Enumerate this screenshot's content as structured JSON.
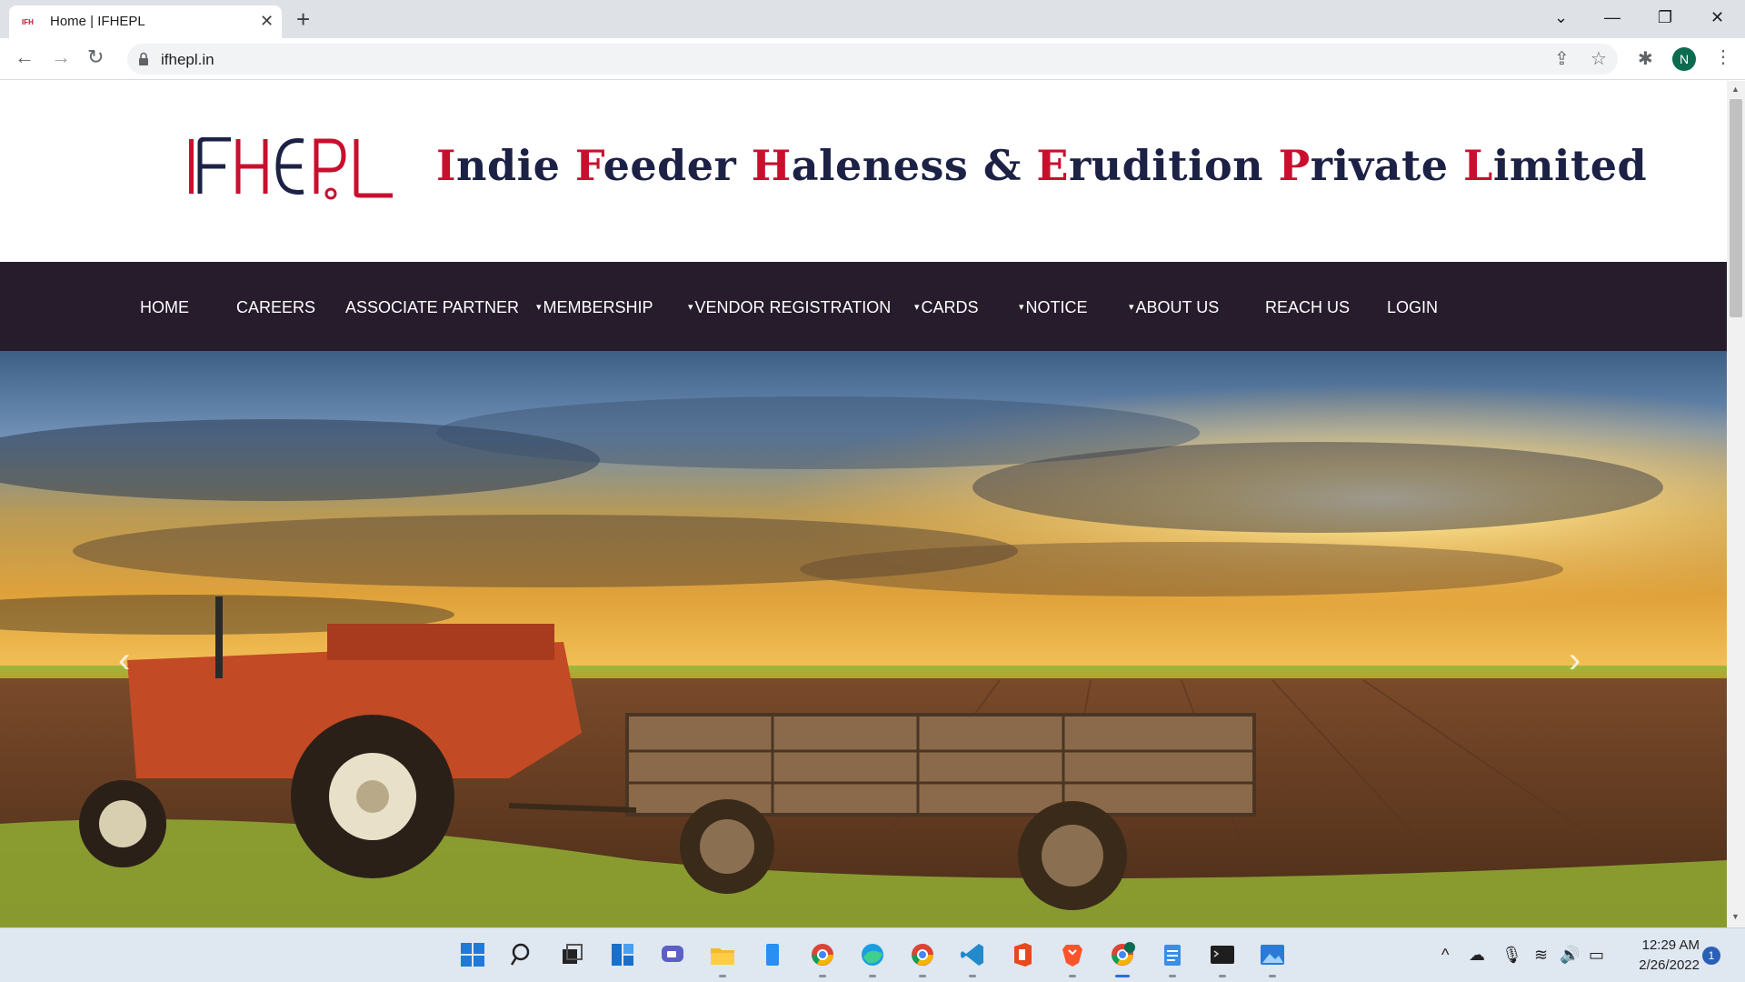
{
  "browser": {
    "tab_title": "Home | IFHEPL",
    "tab_close": "✕",
    "new_tab": "+",
    "url": "ifhepl.in",
    "profile_initial": "N",
    "controls": {
      "tab_list": "⌄",
      "minimize": "—",
      "restore": "❐",
      "close": "✕"
    },
    "nav": {
      "back": "←",
      "forward": "→",
      "reload": "↻"
    },
    "icons": {
      "share": "⇪",
      "bookmark": "☆",
      "extensions": "✱",
      "menu": "⋮"
    }
  },
  "site": {
    "company_name_parts": [
      {
        "cap": "I",
        "rest": "ndie "
      },
      {
        "cap": "F",
        "rest": "eeder "
      },
      {
        "cap": "H",
        "rest": "aleness & "
      },
      {
        "cap": "E",
        "rest": "rudition "
      },
      {
        "cap": "P",
        "rest": "rivate "
      },
      {
        "cap": "L",
        "rest": "imited"
      }
    ],
    "brand_colors": {
      "navy": "#1c2145",
      "red": "#c8102e",
      "nav_bg": "#261c2c"
    },
    "nav_items": [
      {
        "label": "HOME",
        "dropdown": false
      },
      {
        "label": "CAREERS",
        "dropdown": false
      },
      {
        "label": "ASSOCIATE PARTNER",
        "dropdown": false
      },
      {
        "label": "MEMBERSHIP",
        "dropdown": true
      },
      {
        "label": "VENDOR REGISTRATION",
        "dropdown": true
      },
      {
        "label": "CARDS",
        "dropdown": true
      },
      {
        "label": "NOTICE",
        "dropdown": true
      },
      {
        "label": "ABOUT US",
        "dropdown": true
      },
      {
        "label": "REACH US",
        "dropdown": false
      },
      {
        "label": "LOGIN",
        "dropdown": false
      }
    ],
    "caret_glyph": "▾",
    "carousel": {
      "prev": "‹",
      "next": "›"
    }
  },
  "taskbar": {
    "time": "12:29 AM",
    "date": "2/26/2022",
    "notification_count": "1",
    "tray": {
      "chevron": "^",
      "onedrive": "☁",
      "mic": "🎙",
      "wifi": "≋",
      "volume": "🔊",
      "battery": "▭"
    }
  }
}
